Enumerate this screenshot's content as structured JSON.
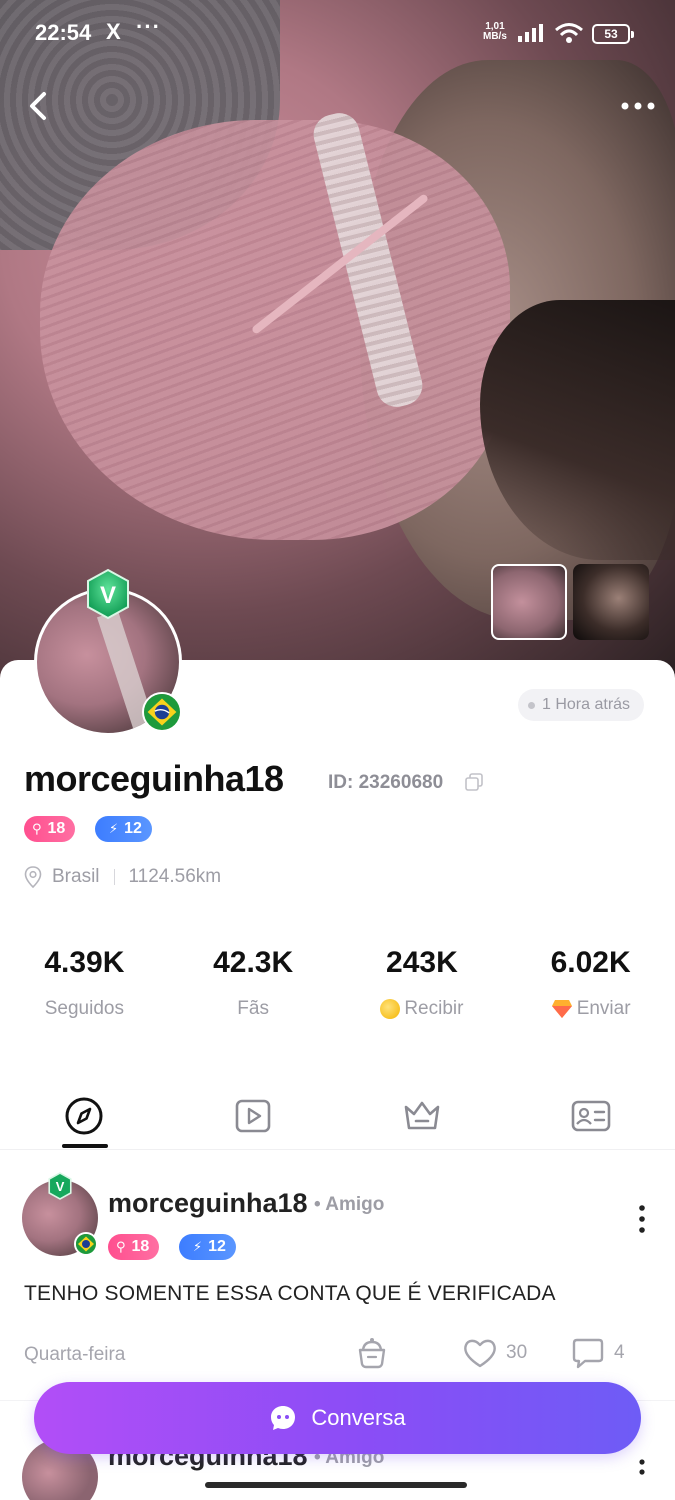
{
  "status_bar": {
    "time": "22:54",
    "app_icon": "X",
    "more": "···",
    "net_speed_top": "1,01",
    "net_speed_bottom": "MB/s",
    "battery": "53"
  },
  "header": {
    "back_icon": "chevron-left-icon",
    "more_icon": "more-horizontal-icon"
  },
  "profile": {
    "last_active": "1 Hora atrás",
    "username": "morceguinha18",
    "id_label": "ID: 23260680",
    "badges": [
      {
        "icon": "⚲",
        "value": "18",
        "color": "#ff5a94"
      },
      {
        "icon": "⚡",
        "value": "12",
        "color": "#4a87ff"
      }
    ],
    "country": "Brasil",
    "distance": "1124.56km"
  },
  "stats": [
    {
      "value": "4.39K",
      "label": "Seguidos"
    },
    {
      "value": "42.3K",
      "label": "Fãs"
    },
    {
      "value": "243K",
      "label": "Recibir"
    },
    {
      "value": "6.02K",
      "label": "Enviar"
    }
  ],
  "tabs": [
    {
      "icon": "compass-icon",
      "active": true
    },
    {
      "icon": "video-play-icon",
      "active": false
    },
    {
      "icon": "crown-icon",
      "active": false
    },
    {
      "icon": "profile-card-icon",
      "active": false
    }
  ],
  "post": {
    "username": "morceguinha18",
    "relation": "• Amigo",
    "badges": [
      {
        "icon": "⚲",
        "value": "18"
      },
      {
        "icon": "⚡",
        "value": "12"
      }
    ],
    "text": "TENHO SOMENTE ESSA CONTA QUE É VERIFICADA",
    "date": "Quarta-feira",
    "likes": "30",
    "comments": "4"
  },
  "post2": {
    "username": "morceguinha18",
    "relation": "• Amigo"
  },
  "chat_button": {
    "label": "Conversa"
  },
  "colors": {
    "accent_gradient_start": "#b24ef7",
    "accent_gradient_end": "#6e5cf6",
    "badge_pink": "#ff5a94",
    "badge_blue": "#4a87ff"
  }
}
